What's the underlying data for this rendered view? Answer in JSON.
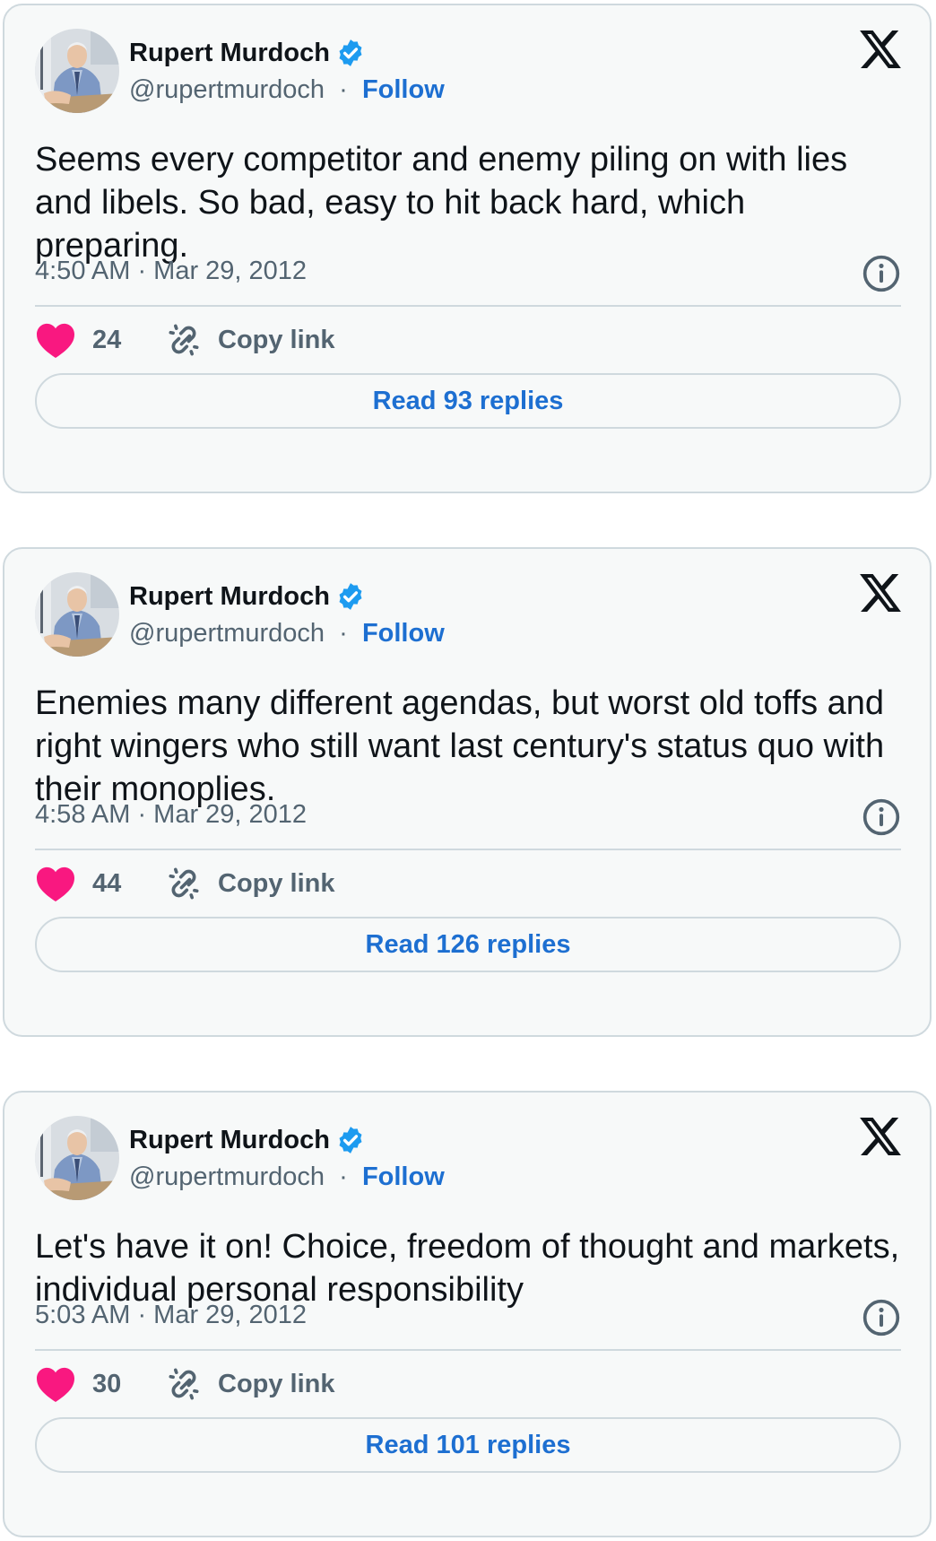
{
  "tweets": [
    {
      "author": {
        "name": "Rupert Murdoch",
        "handle": "@rupertmurdoch",
        "separator": "·",
        "follow_label": "Follow",
        "verified": true
      },
      "text": "Seems every competitor and enemy piling on with lies and libels.  So bad, easy to hit back hard, which preparing.",
      "timestamp": "4:50 AM · Mar 29, 2012",
      "likes": "24",
      "copy_link_label": "Copy link",
      "replies_label": "Read 93 replies"
    },
    {
      "author": {
        "name": "Rupert Murdoch",
        "handle": "@rupertmurdoch",
        "separator": "·",
        "follow_label": "Follow",
        "verified": true
      },
      "text": "Enemies many different agendas, but worst old toffs and right wingers who still want last century's status quo with their monoplies.",
      "timestamp": "4:58 AM · Mar 29, 2012",
      "likes": "44",
      "copy_link_label": "Copy link",
      "replies_label": "Read 126 replies"
    },
    {
      "author": {
        "name": "Rupert Murdoch",
        "handle": "@rupertmurdoch",
        "separator": "·",
        "follow_label": "Follow",
        "verified": true
      },
      "text": "Let's have it on!  Choice, freedom of thought and markets, individual personal responsibility",
      "timestamp": "5:03 AM · Mar 29, 2012",
      "likes": "30",
      "copy_link_label": "Copy link",
      "replies_label": "Read 101 replies"
    }
  ],
  "icons": {
    "brand": "x-logo-icon",
    "verified": "verified-badge-icon",
    "info": "info-icon",
    "like": "heart-icon",
    "copy": "link-icon"
  },
  "colors": {
    "follow": "#1d6fd1",
    "verified": "#1d9bf0",
    "heart": "#f91880",
    "card_bg": "#f7f9f9",
    "border": "#cfd9de"
  }
}
